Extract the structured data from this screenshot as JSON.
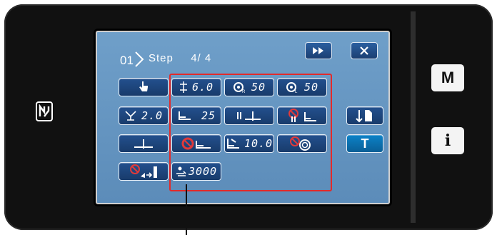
{
  "step": {
    "number": "01",
    "label": "Step",
    "current": "4",
    "total": "4"
  },
  "toolbar": {
    "forward_icon": "fast-forward-icon",
    "close_icon": "close-icon"
  },
  "values": {
    "stitch_pitch": "6.0",
    "tension_r": "50",
    "tension_l": "50",
    "presser_height": "2.0",
    "foot_pressure": "25",
    "lift_amount": "10.0",
    "counter": "3000"
  },
  "side_buttons": {
    "m_label": "M",
    "info_label": "i",
    "t_label": "T"
  },
  "colors": {
    "screen_bg": "#6699c4",
    "key_bg": "#1d4478",
    "highlight": "#e32a2a",
    "t_key": "#0b73b4"
  }
}
